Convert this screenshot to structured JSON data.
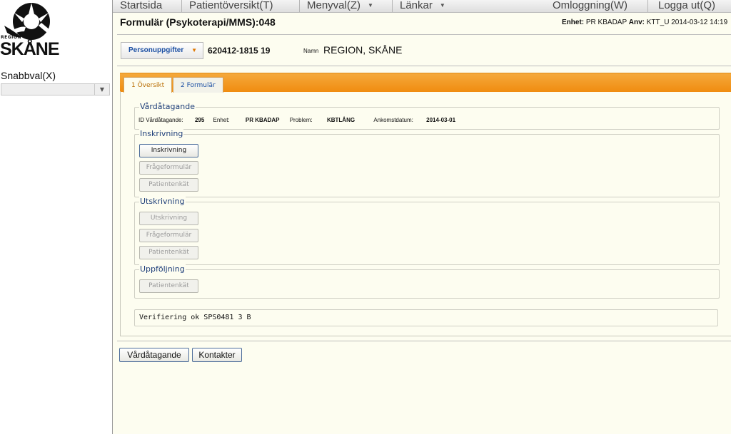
{
  "logo": {
    "region": "REGION",
    "name": "SKÅNE"
  },
  "sidebar": {
    "snabbval_label": "Snabbval(X)",
    "snabbval_value": ""
  },
  "nav": {
    "startsida": "Startsida",
    "patientoversikt": "Patientöversikt(T)",
    "menyval": "Menyval(Z)",
    "lankar": "Länkar",
    "omloggning": "Omloggning(W)",
    "logga_ut": "Logga ut(Q)"
  },
  "header": {
    "form_title": "Formulär (Psykoterapi/MMS):048",
    "enhet_label": "Enhet:",
    "enhet_value": "PR KBADAP",
    "anv_label": "Anv:",
    "anv_value": "KTT_U",
    "datetime": "2014-03-12 14:19"
  },
  "patient": {
    "personuppgifter_label": "Personuppgifter",
    "personnummer": "620412-1815 19",
    "namn_label": "Namn",
    "namn_value": "REGION, SKÅNE"
  },
  "tabs": [
    {
      "label": "1 Översikt",
      "active": true
    },
    {
      "label": "2 Formulär",
      "active": false
    }
  ],
  "vardatagande": {
    "title": "Vårdåtagande",
    "id_label": "ID Vårdåtagande:",
    "id_value": "295",
    "enhet_label": "Enhet:",
    "enhet_value": "PR KBADAP",
    "problem_label": "Problem:",
    "problem_value": "KBTLÅNG",
    "ankomst_label": "Ankomstdatum:",
    "ankomst_value": "2014-03-01"
  },
  "inskrivning": {
    "title": "Inskrivning",
    "buttons": [
      "Inskrivning",
      "Frågeformulär",
      "Patientenkät"
    ]
  },
  "utskrivning": {
    "title": "Utskrivning",
    "buttons": [
      "Utskrivning",
      "Frågeformulär",
      "Patientenkät"
    ]
  },
  "uppfoljning": {
    "title": "Uppföljning",
    "buttons": [
      "Patientenkät"
    ]
  },
  "verification": "Verifiering ok SPS0481 3 B",
  "bottom_buttons": [
    "Vårdåtagande",
    "Kontakter"
  ],
  "colors": {
    "tab_bar": "#f08c10",
    "link_blue": "#1b4fa3",
    "background": "#fdfdf0"
  }
}
